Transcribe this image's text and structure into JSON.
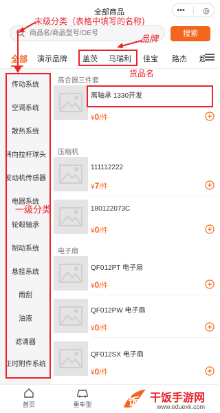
{
  "window": {
    "title": "全部商品",
    "menu_icon": "•••",
    "close_icon": "◎"
  },
  "search": {
    "placeholder": "商品名/商品型号/OE号",
    "button_label": "搜索"
  },
  "brand_tabs": {
    "items": [
      "全部",
      "演示品牌",
      "盖茨",
      "马瑞利",
      "佳宝",
      "路杰",
      "超"
    ],
    "active_index": 0
  },
  "sidebar": {
    "items": [
      "传动系统",
      "空调系统",
      "散热系统",
      "转向拉杆球头",
      "发动机传感器",
      "电器系统",
      "轮毂轴承",
      "制动系统",
      "悬挂系统",
      "雨刮",
      "油液",
      "滤清器",
      "正时附件系统"
    ]
  },
  "sections": [
    {
      "title": "高合器三件套",
      "products": [
        {
          "name": "离轴承 1330开发",
          "price": "0",
          "unit": "/件"
        }
      ]
    },
    {
      "title": "压缩机",
      "products": [
        {
          "name": "111112222",
          "price": "7",
          "unit": "/件"
        },
        {
          "name": "180122073C",
          "price": "0",
          "unit": "/件"
        }
      ]
    },
    {
      "title": "电子扇",
      "products": [
        {
          "name": "QF012PT 电子扇",
          "price": "0",
          "unit": "/件"
        },
        {
          "name": "QF012PW 电子扇",
          "price": "0",
          "unit": "/件"
        },
        {
          "name": "QF012SX 电子扇",
          "price": "0",
          "unit": "/件"
        }
      ]
    }
  ],
  "currency": "¥",
  "annotations": {
    "top": "末级分类（表格中填写的名称)",
    "brand": "品牌",
    "product_name": "货品名",
    "first_level": "一级分类"
  },
  "bottom_nav": {
    "items": [
      "首页",
      "重车型"
    ]
  },
  "watermark": {
    "name": "干饭手游网",
    "url": "www.eduexk.com"
  },
  "colors": {
    "accent": "#f3661d",
    "annotation": "#e8232b"
  }
}
